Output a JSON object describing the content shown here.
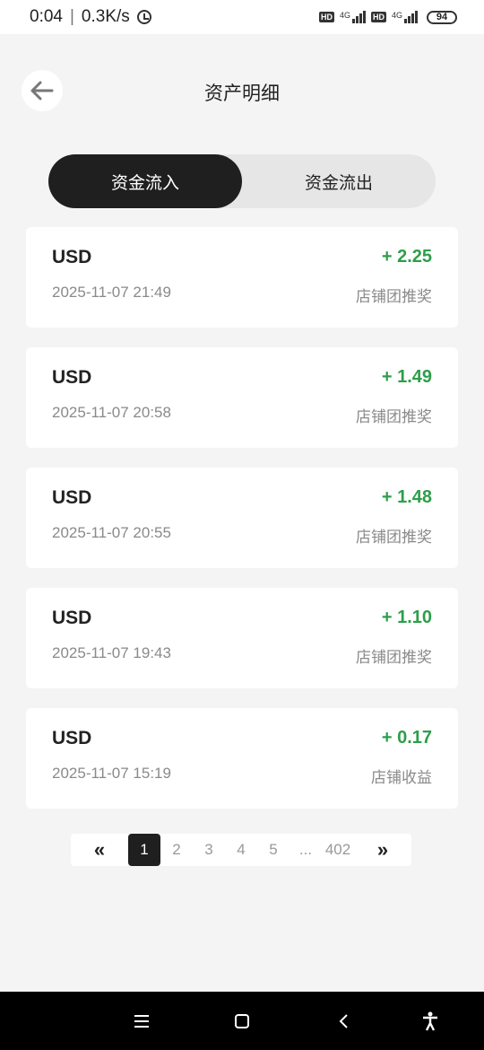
{
  "status": {
    "time": "0:04",
    "separator": "|",
    "speed": "0.3K/s",
    "hd1": "HD",
    "net1": "4G",
    "hd2": "HD",
    "net2": "4G",
    "battery": "94"
  },
  "header": {
    "title": "资产明细"
  },
  "tabs": [
    {
      "label": "资金流入",
      "active": true
    },
    {
      "label": "资金流出",
      "active": false
    }
  ],
  "records": [
    {
      "currency": "USD",
      "amount": "+ 2.25",
      "datetime": "2025-11-07 21:49",
      "type": "店铺团推奖"
    },
    {
      "currency": "USD",
      "amount": "+ 1.49",
      "datetime": "2025-11-07 20:58",
      "type": "店铺团推奖"
    },
    {
      "currency": "USD",
      "amount": "+ 1.48",
      "datetime": "2025-11-07 20:55",
      "type": "店铺团推奖"
    },
    {
      "currency": "USD",
      "amount": "+ 1.10",
      "datetime": "2025-11-07 19:43",
      "type": "店铺团推奖"
    },
    {
      "currency": "USD",
      "amount": "+ 0.17",
      "datetime": "2025-11-07 15:19",
      "type": "店铺收益"
    }
  ],
  "pagination": {
    "first": "«",
    "pages": [
      "1",
      "2",
      "3",
      "4",
      "5"
    ],
    "ellipsis": "...",
    "last_page": "402",
    "last": "»",
    "current": "1"
  },
  "colors": {
    "accent_dark": "#1f1f1f",
    "income_green": "#2e9e4a"
  },
  "icons": {
    "back": "arrow-left-icon",
    "nav_menu": "menu-icon",
    "nav_home": "home-square-icon",
    "nav_back": "chevron-left-icon",
    "nav_accessibility": "accessibility-icon"
  }
}
